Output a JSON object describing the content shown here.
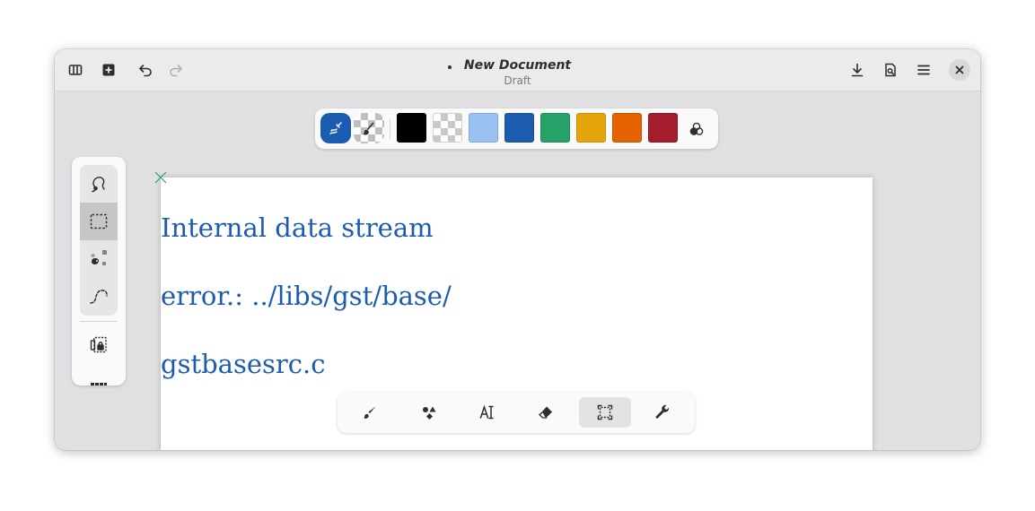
{
  "window": {
    "title": "New Document",
    "subtitle": "Draft",
    "modified": true
  },
  "headerbar": {
    "left_buttons": [
      {
        "name": "toggle-sidebar",
        "icon": "panels-icon",
        "enabled": true
      },
      {
        "name": "new-document",
        "icon": "add-document-icon",
        "enabled": true
      },
      {
        "name": "undo",
        "icon": "undo-icon",
        "enabled": true
      },
      {
        "name": "redo",
        "icon": "redo-icon",
        "enabled": false
      }
    ],
    "right_buttons": [
      {
        "name": "save",
        "icon": "download-icon"
      },
      {
        "name": "export",
        "icon": "document-preview-icon"
      },
      {
        "name": "main-menu",
        "icon": "hamburger-menu-icon"
      },
      {
        "name": "close",
        "icon": "close-icon"
      }
    ]
  },
  "palette": {
    "main_color": "#1c5cb0",
    "secondary_color": "transparent",
    "swatches": [
      {
        "name": "black",
        "color": "#000000"
      },
      {
        "name": "transparent",
        "color": "transparent"
      },
      {
        "name": "light-blue",
        "color": "#99c1f1"
      },
      {
        "name": "blue",
        "color": "#1c5cb0"
      },
      {
        "name": "green",
        "color": "#26a269"
      },
      {
        "name": "yellow",
        "color": "#e5a50a"
      },
      {
        "name": "orange",
        "color": "#e66100"
      },
      {
        "name": "red",
        "color": "#a51d2d"
      }
    ],
    "mix_icon": "color-mix-icon"
  },
  "tools_panel": {
    "selection_tools": [
      {
        "name": "free-selection",
        "icon": "lasso-icon",
        "active": false
      },
      {
        "name": "rectangle-selection",
        "icon": "rect-select-icon",
        "active": true
      },
      {
        "name": "color-selection",
        "icon": "color-select-icon",
        "active": false
      },
      {
        "name": "path-selection",
        "icon": "path-select-icon",
        "active": false
      }
    ],
    "extra_tools": [
      {
        "name": "lock-selection",
        "icon": "lock-layer-icon"
      },
      {
        "name": "more-tools",
        "icon": "more-tools-icon"
      }
    ]
  },
  "canvas": {
    "text_lines": [
      "Internal data stream",
      "error.: ../libs/gst/base/",
      "gstbasesrc.c"
    ],
    "text_color": "#1c5cb0",
    "origin_marker_color": "#26a269"
  },
  "bottom_toolbar": {
    "buttons": [
      {
        "name": "brush",
        "icon": "brush-icon",
        "active": false
      },
      {
        "name": "shapes",
        "icon": "shapes-icon",
        "active": false
      },
      {
        "name": "text",
        "icon": "text-tool-icon",
        "active": false
      },
      {
        "name": "eraser",
        "icon": "eraser-icon",
        "active": false
      },
      {
        "name": "selection",
        "icon": "selection-icon",
        "active": true
      },
      {
        "name": "tools",
        "icon": "wrench-icon",
        "active": false
      }
    ]
  }
}
